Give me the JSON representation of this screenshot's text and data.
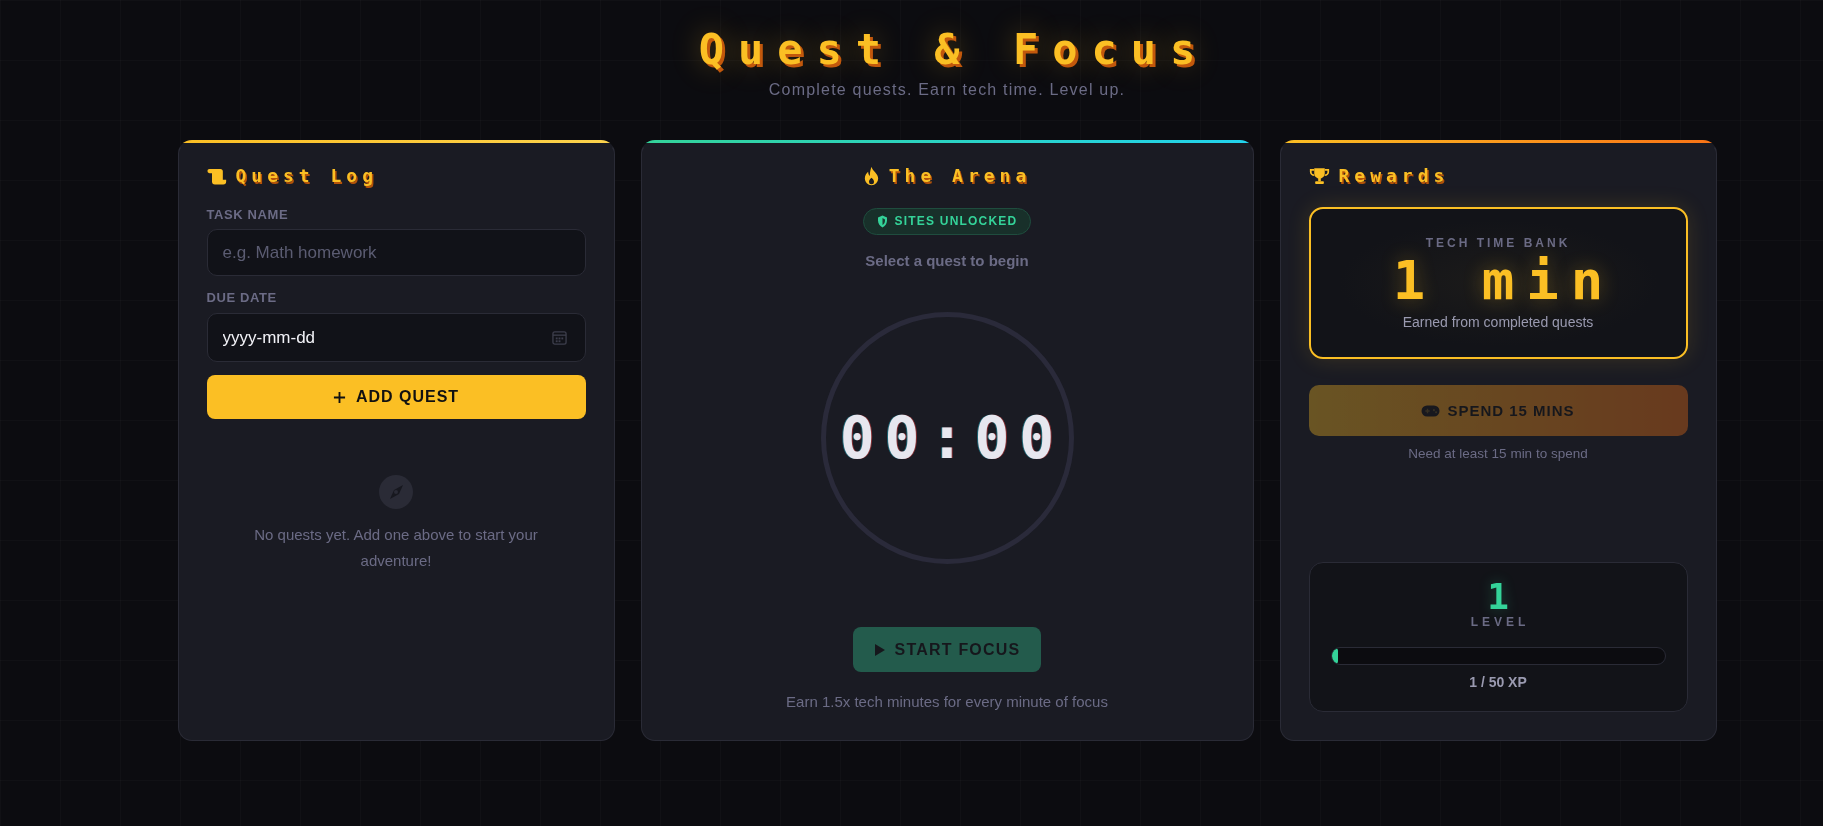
{
  "header": {
    "title": "Quest & Focus",
    "subtitle": "Complete quests. Earn tech time. Level up."
  },
  "quest_log": {
    "title": "Quest Log",
    "fields": [
      {
        "kind": "text",
        "label": "TASK NAME",
        "placeholder": "e.g. Math homework"
      },
      {
        "kind": "date",
        "label": "DUE DATE",
        "value": "yyyy-mm-dd"
      }
    ],
    "add_button": {
      "label": "ADD QUEST"
    },
    "empty_message": "No quests yet. Add one above to start your adventure!"
  },
  "arena": {
    "title": "The Arena",
    "badge": "SITES UNLOCKED",
    "prompt": "Select a quest to begin",
    "timer": "00:00",
    "start_button": {
      "label": "START FOCUS",
      "disabled": true
    },
    "note": "Earn 1.5x tech minutes for every minute of focus"
  },
  "rewards": {
    "title": "Rewards",
    "bank": {
      "label": "TECH TIME BANK",
      "value": "1 min",
      "caption": "Earned from completed quests"
    },
    "spend_button": {
      "label": "SPEND 15 MINS",
      "disabled": true
    },
    "spend_note": "Need at least 15 min to spend",
    "level": {
      "value": "1",
      "label": "LEVEL",
      "xp_bar": {
        "level": 0.02
      },
      "reading": "1 / 50 XP"
    }
  }
}
